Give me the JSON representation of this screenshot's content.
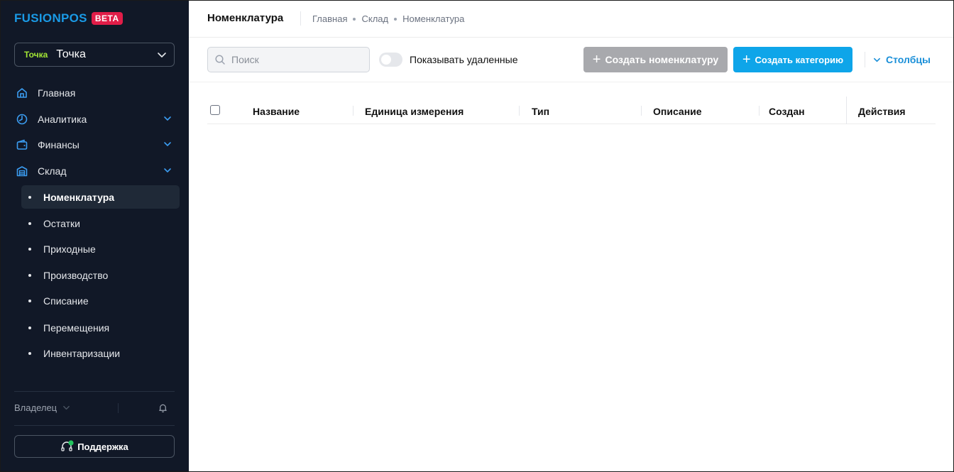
{
  "brand": {
    "name": "FUSIONPOS",
    "badge": "BETA",
    "color": "#1a9ae6",
    "badge_color": "#e11d48"
  },
  "point": {
    "badge": "Точка",
    "name": "Точка"
  },
  "sidebar": {
    "items": [
      {
        "label": "Главная",
        "icon": "home-icon",
        "has_chevron": false
      },
      {
        "label": "Аналитика",
        "icon": "clock-pie-icon",
        "has_chevron": true
      },
      {
        "label": "Финансы",
        "icon": "wallet-icon",
        "has_chevron": true
      },
      {
        "label": "Склад",
        "icon": "warehouse-icon",
        "has_chevron": true
      }
    ],
    "subitems": [
      {
        "label": "Номенклатура",
        "active": true
      },
      {
        "label": "Остатки",
        "active": false
      },
      {
        "label": "Приходные",
        "active": false
      },
      {
        "label": "Производство",
        "active": false
      },
      {
        "label": "Списание",
        "active": false
      },
      {
        "label": "Перемещения",
        "active": false
      },
      {
        "label": "Инвентаризации",
        "active": false
      }
    ],
    "owner_label": "Владелец",
    "support_label": "Поддержка"
  },
  "header": {
    "title": "Номенклатура",
    "breadcrumb": [
      "Главная",
      "Склад",
      "Номенклатура"
    ]
  },
  "toolbar": {
    "search_placeholder": "Поиск",
    "search_value": "",
    "show_deleted_label": "Показывать удаленные",
    "show_deleted_on": false,
    "create_nomenclature_label": "Создать номенклатуру",
    "create_category_label": "Создать категорию",
    "columns_label": "Столбцы",
    "accent_color": "#0ea5e9"
  },
  "table": {
    "columns": [
      "Название",
      "Единица измерения",
      "Тип",
      "Описание",
      "Создан",
      "Действия"
    ],
    "rows": []
  }
}
